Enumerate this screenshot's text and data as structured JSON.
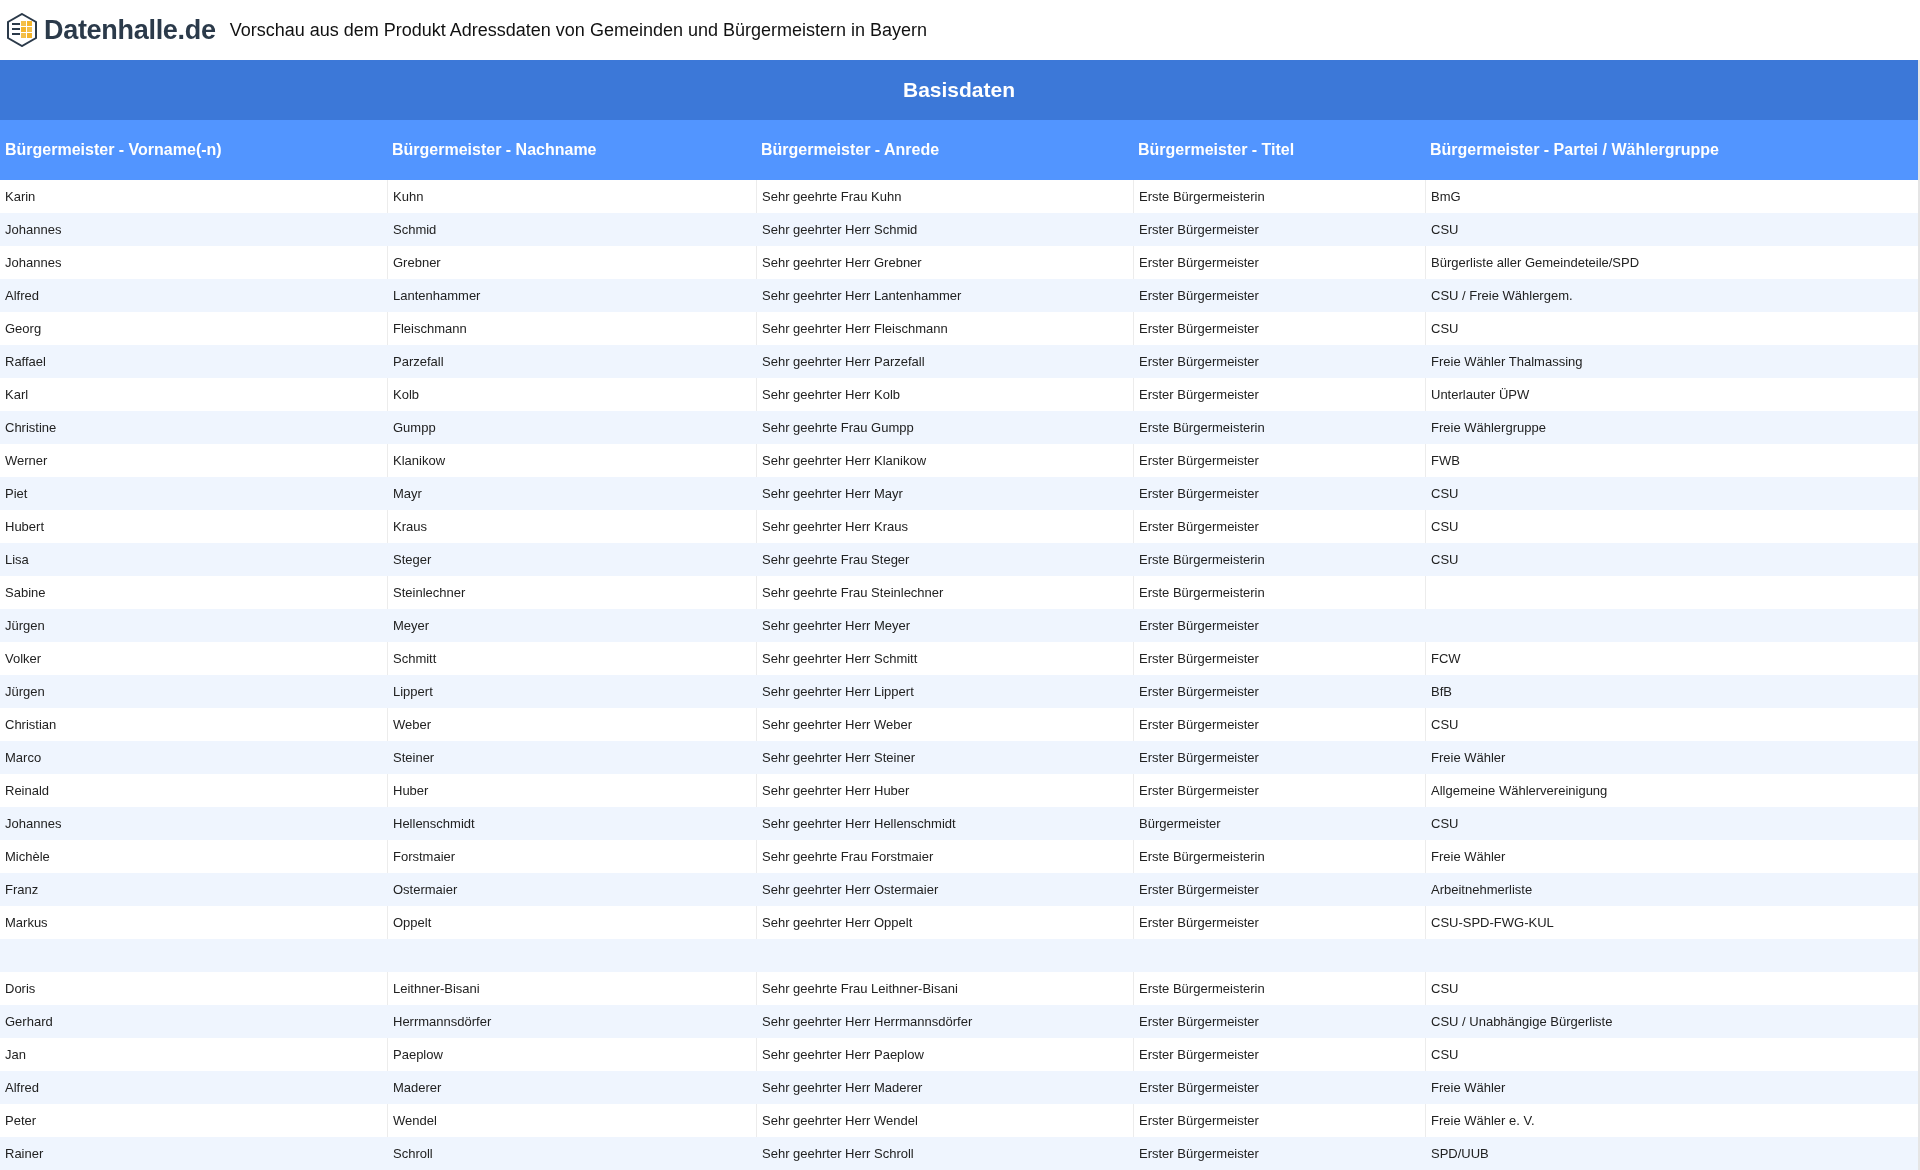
{
  "header": {
    "logo_text": "Datenhalle.de",
    "title": "Vorschau aus dem Produkt Adressdaten von Gemeinden und Bürgermeistern in Bayern"
  },
  "table": {
    "group_title": "Basisdaten",
    "columns": [
      "Bürgermeister - Vorname(-n)",
      "Bürgermeister - Nachname",
      "Bürgermeister - Anrede",
      "Bürgermeister - Titel",
      "Bürgermeister - Partei / Wählergruppe"
    ],
    "rows": [
      [
        "Karin",
        "Kuhn",
        "Sehr geehrte Frau Kuhn",
        "Erste Bürgermeisterin",
        "BmG"
      ],
      [
        "Johannes",
        "Schmid",
        "Sehr geehrter Herr Schmid",
        "Erster Bürgermeister",
        "CSU"
      ],
      [
        "Johannes",
        "Grebner",
        "Sehr geehrter Herr Grebner",
        "Erster Bürgermeister",
        "Bürgerliste aller Gemeindeteile/SPD"
      ],
      [
        "Alfred",
        "Lantenhammer",
        "Sehr geehrter Herr Lantenhammer",
        "Erster Bürgermeister",
        "CSU / Freie Wählergem."
      ],
      [
        "Georg",
        "Fleischmann",
        "Sehr geehrter Herr Fleischmann",
        "Erster Bürgermeister",
        "CSU"
      ],
      [
        "Raffael",
        "Parzefall",
        "Sehr geehrter Herr Parzefall",
        "Erster Bürgermeister",
        "Freie Wähler Thalmassing"
      ],
      [
        "Karl",
        "Kolb",
        "Sehr geehrter Herr Kolb",
        "Erster Bürgermeister",
        "Unterlauter ÜPW"
      ],
      [
        "Christine",
        "Gumpp",
        "Sehr geehrte Frau Gumpp",
        "Erste Bürgermeisterin",
        "Freie Wählergruppe"
      ],
      [
        "Werner",
        "Klanikow",
        "Sehr geehrter Herr Klanikow",
        "Erster Bürgermeister",
        "FWB"
      ],
      [
        "Piet",
        "Mayr",
        "Sehr geehrter Herr Mayr",
        "Erster Bürgermeister",
        "CSU"
      ],
      [
        "Hubert",
        "Kraus",
        "Sehr geehrter Herr Kraus",
        "Erster Bürgermeister",
        "CSU"
      ],
      [
        "Lisa",
        "Steger",
        "Sehr geehrte Frau Steger",
        "Erste Bürgermeisterin",
        "CSU"
      ],
      [
        "Sabine",
        "Steinlechner",
        "Sehr geehrte Frau Steinlechner",
        "Erste Bürgermeisterin",
        null
      ],
      [
        "Jürgen",
        "Meyer",
        "Sehr geehrter Herr Meyer",
        "Erster Bürgermeister",
        null
      ],
      [
        "Volker",
        "Schmitt",
        "Sehr geehrter Herr Schmitt",
        "Erster Bürgermeister",
        "FCW"
      ],
      [
        "Jürgen",
        "Lippert",
        "Sehr geehrter Herr Lippert",
        "Erster Bürgermeister",
        "BfB"
      ],
      [
        "Christian",
        "Weber",
        "Sehr geehrter Herr Weber",
        "Erster Bürgermeister",
        "CSU"
      ],
      [
        "Marco",
        "Steiner",
        "Sehr geehrter Herr Steiner",
        "Erster Bürgermeister",
        "Freie Wähler"
      ],
      [
        "Reinald",
        "Huber",
        "Sehr geehrter Herr Huber",
        "Erster Bürgermeister",
        "Allgemeine Wählervereinigung"
      ],
      [
        "Johannes",
        "Hellenschmidt",
        "Sehr geehrter Herr Hellenschmidt",
        "Bürgermeister",
        "CSU"
      ],
      [
        "Michèle",
        "Forstmaier",
        "Sehr geehrte Frau Forstmaier",
        "Erste Bürgermeisterin",
        "Freie Wähler"
      ],
      [
        "Franz",
        "Ostermaier",
        "Sehr geehrter Herr Ostermaier",
        "Erster Bürgermeister",
        "Arbeitnehmerliste"
      ],
      [
        "Markus",
        "Oppelt",
        "Sehr geehrter Herr Oppelt",
        "Erster Bürgermeister",
        "CSU-SPD-FWG-KUL"
      ],
      [
        null,
        null,
        null,
        null,
        null
      ],
      [
        "Doris",
        "Leithner-Bisani",
        "Sehr geehrte Frau Leithner-Bisani",
        "Erste Bürgermeisterin",
        "CSU"
      ],
      [
        "Gerhard",
        "Herrmannsdörfer",
        "Sehr geehrter Herr Herrmannsdörfer",
        "Erster Bürgermeister",
        "CSU / Unabhängige Bürgerliste"
      ],
      [
        "Jan",
        "Paeplow",
        "Sehr geehrter Herr Paeplow",
        "Erster Bürgermeister",
        "CSU"
      ],
      [
        "Alfred",
        "Maderer",
        "Sehr geehrter Herr Maderer",
        "Erster Bürgermeister",
        "Freie Wähler"
      ],
      [
        "Peter",
        "Wendel",
        "Sehr geehrter Herr Wendel",
        "Erster Bürgermeister",
        "Freie Wähler e. V."
      ],
      [
        "Rainer",
        "Schroll",
        "Sehr geehrter Herr Schroll",
        "Erster Bürgermeister",
        "SPD/UUB"
      ]
    ]
  }
}
